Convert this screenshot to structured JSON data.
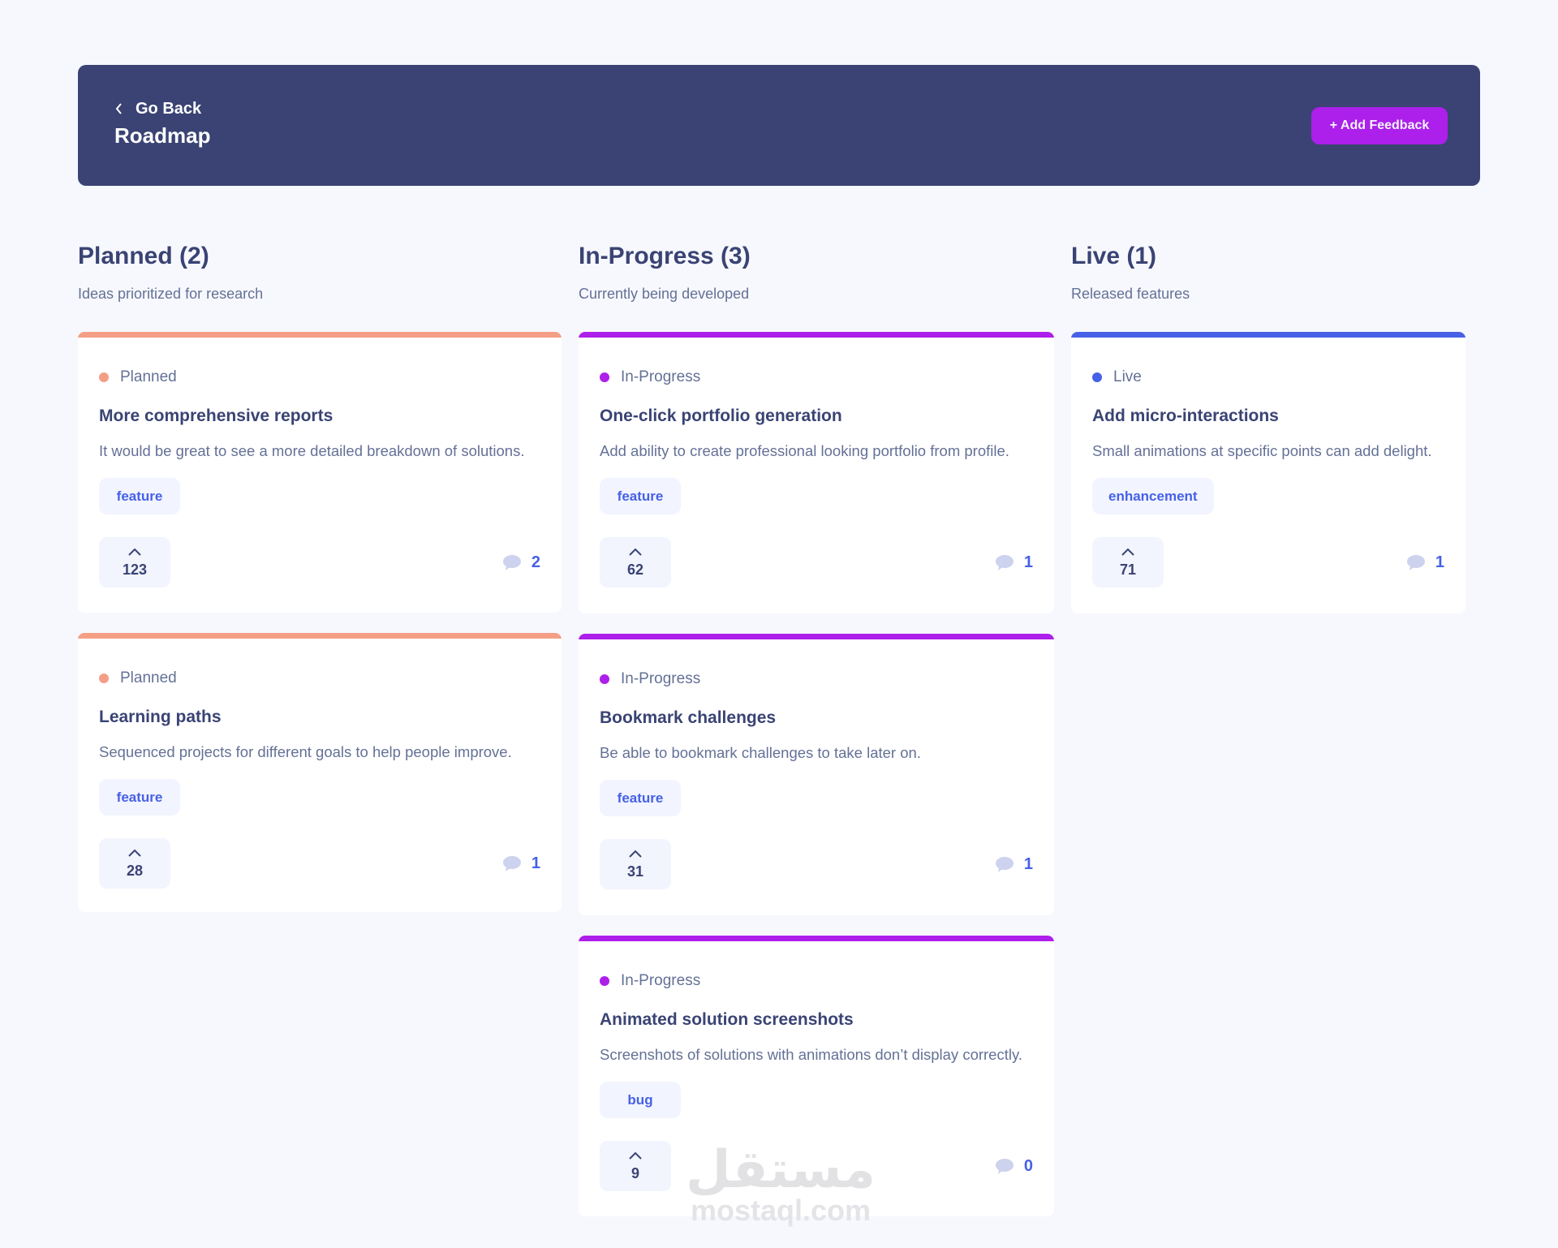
{
  "header": {
    "go_back_label": "Go Back",
    "title": "Roadmap",
    "add_button_label": "+ Add Feedback"
  },
  "colors": {
    "header_bg": "#3a4374",
    "accent_purple": "#ad1fea",
    "planned": "#f49f85",
    "in_progress": "#ad1fea",
    "live": "#4661e6",
    "page_bg": "#f7f8fd"
  },
  "columns": [
    {
      "title": "Planned (2)",
      "description": "Ideas prioritized for research",
      "cards": [
        {
          "status": "Planned",
          "title": "More comprehensive reports",
          "description": "It would be great to see a more detailed breakdown of solutions.",
          "tag": "feature",
          "upvotes": "123",
          "comments": "2"
        },
        {
          "status": "Planned",
          "title": "Learning paths",
          "description": "Sequenced projects for different goals to help people improve.",
          "tag": "feature",
          "upvotes": "28",
          "comments": "1"
        }
      ]
    },
    {
      "title": "In-Progress (3)",
      "description": "Currently being developed",
      "cards": [
        {
          "status": "In-Progress",
          "title": "One-click portfolio generation",
          "description": "Add ability to create professional looking portfolio from profile.",
          "tag": "feature",
          "upvotes": "62",
          "comments": "1"
        },
        {
          "status": "In-Progress",
          "title": "Bookmark challenges",
          "description": "Be able to bookmark challenges to take later on.",
          "tag": "feature",
          "upvotes": "31",
          "comments": "1"
        },
        {
          "status": "In-Progress",
          "title": "Animated solution screenshots",
          "description": "Screenshots of solutions with animations don’t display correctly.",
          "tag": "bug",
          "upvotes": "9",
          "comments": "0"
        }
      ]
    },
    {
      "title": "Live (1)",
      "description": "Released features",
      "cards": [
        {
          "status": "Live",
          "title": "Add micro-interactions",
          "description": "Small animations at specific points can add delight.",
          "tag": "enhancement",
          "upvotes": "71",
          "comments": "1"
        }
      ]
    }
  ],
  "watermark": {
    "arabic": "مستقل",
    "latin": "mostaql.com"
  }
}
